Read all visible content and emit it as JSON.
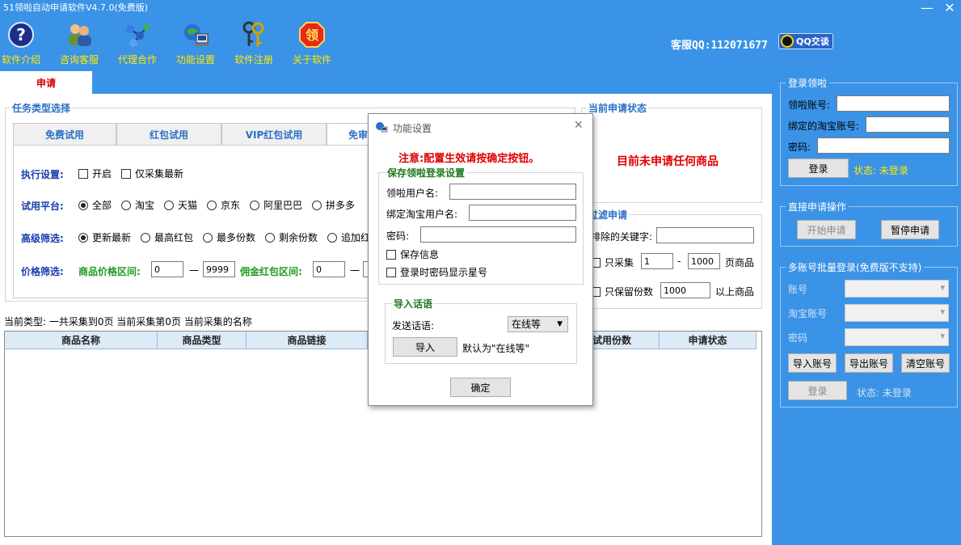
{
  "app": {
    "title": "51领啦自动申请软件V4.7.0(免费版)"
  },
  "window": {
    "minimize": "—",
    "close": "✕"
  },
  "toolbar": {
    "items": [
      {
        "label": "软件介绍",
        "icon": "help-icon"
      },
      {
        "label": "咨询客服",
        "icon": "users-icon"
      },
      {
        "label": "代理合作",
        "icon": "network-icon"
      },
      {
        "label": "功能设置",
        "icon": "settings-globe-icon"
      },
      {
        "label": "软件注册",
        "icon": "keys-icon"
      },
      {
        "label": "关于软件",
        "icon": "about-badge-icon"
      }
    ],
    "about_glyph": "领",
    "kefu": "客服QQ:112071677",
    "qq_button": "QQ交谈"
  },
  "main_tab": "申请",
  "task": {
    "group_title": "任务类型选择",
    "subtabs": [
      "免费试用",
      "红包试用",
      "VIP红包试用",
      "免审"
    ],
    "exec_label": "执行设置:",
    "exec_options": [
      {
        "label": "开启",
        "checked": false
      },
      {
        "label": "仅采集最新",
        "checked": false
      }
    ],
    "platform_label": "试用平台:",
    "platforms": [
      {
        "label": "全部",
        "checked": true
      },
      {
        "label": "淘宝",
        "checked": false
      },
      {
        "label": "天猫",
        "checked": false
      },
      {
        "label": "京东",
        "checked": false
      },
      {
        "label": "阿里巴巴",
        "checked": false
      },
      {
        "label": "拼多多",
        "checked": false
      }
    ],
    "filter_label": "高级筛选:",
    "filters": [
      {
        "label": "更新最新",
        "checked": true
      },
      {
        "label": "最高红包",
        "checked": false
      },
      {
        "label": "最多份数",
        "checked": false
      },
      {
        "label": "剩余份数",
        "checked": false
      },
      {
        "label": "追加红",
        "checked": false
      }
    ],
    "price_label": "价格筛选:",
    "price_range_label": "商品价格区间:",
    "price_min": "0",
    "price_max": "9999",
    "dash": "一",
    "bonus_range_label": "佣金红包区间:",
    "bonus_min": "0"
  },
  "status": {
    "group_title": "当前申请状态",
    "message": "目前未申请任何商品"
  },
  "filter_apply": {
    "group_title": "过滤申请",
    "exclude_label": "排除的关键字:",
    "exclude_value": "",
    "collect_only_label": "只采集",
    "page_from": "1",
    "page_dash": "-",
    "page_to": "1000",
    "page_suffix": "页商品",
    "keep_label": "只保留份数",
    "keep_value": "1000",
    "keep_suffix": "以上商品"
  },
  "info_line": "当前类型:  一共采集到0页  当前采集第0页  当前采集的名称",
  "table": {
    "columns": [
      "商品名称",
      "商品类型",
      "商品链接",
      "试用份数",
      "申请状态"
    ]
  },
  "login": {
    "group_title": "登录领啦",
    "account_label": "领啦账号:",
    "taobao_label": "绑定的淘宝账号:",
    "password_label": "密码:",
    "login_button": "登录",
    "status": "状态: 未登录"
  },
  "direct": {
    "group_title": "直接申请操作",
    "start_button": "开始申请",
    "pause_button": "暂停申请"
  },
  "batch": {
    "group_title": "多账号批量登录(免费版不支持)",
    "account_label": "账号",
    "taobao_label": "淘宝账号",
    "password_label": "密码",
    "import_button": "导入账号",
    "export_button": "导出账号",
    "clear_button": "清空账号",
    "login_button": "登录",
    "status": "状态: 未登录"
  },
  "dialog": {
    "title": "功能设置",
    "close": "✕",
    "notice": "注意:配置生效请按确定按钮。",
    "save_group": "保存领啦登录设置",
    "username_label": "领啦用户名:",
    "taobao_label": "绑定淘宝用户名:",
    "password_label": "密码:",
    "save_info": "保存信息",
    "show_stars": "登录时密码显示星号",
    "import_group": "导入话语",
    "send_label": "发送话语:",
    "send_value": "在线等",
    "import_button": "导入",
    "default_note": "默认为\"在线等\"",
    "ok_button": "确定"
  }
}
